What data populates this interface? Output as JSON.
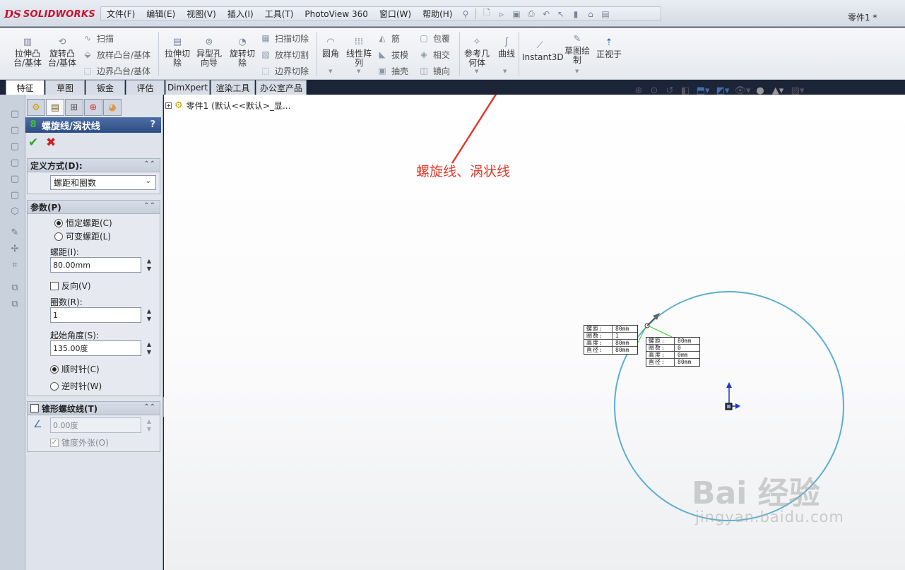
{
  "app": {
    "logo_ds": "DS",
    "logo_text": "SOLIDWORKS",
    "document_title": "零件1 *"
  },
  "menu": {
    "items": [
      "文件(F)",
      "编辑(E)",
      "视图(V)",
      "插入(I)",
      "工具(T)",
      "PhotoView 360",
      "窗口(W)",
      "帮助(H)"
    ]
  },
  "commands": {
    "extrude_boss": "拉伸凸台/基体",
    "revolve_boss": "旋转凸台/基体",
    "sweep": "扫描",
    "loft_boss": "放样凸台/基体",
    "boundary_boss": "边界凸台/基体",
    "extrude_cut": "拉伸切除",
    "hole_wizard": "异型孔向导",
    "revolve_cut": "旋转切除",
    "swept_cut": "扫描切除",
    "lofted_cut": "放样切割",
    "boundary_cut": "边界切除",
    "fillet": "圆角",
    "linear_pattern": "线性阵列",
    "rib": "筋",
    "draft": "拔模",
    "shell": "抽壳",
    "wrap": "包覆",
    "intersect": "相交",
    "mirror": "镜向",
    "ref_geometry": "参考几何体",
    "curves": "曲线",
    "instant3d": "Instant3D",
    "sketch": "草图绘制",
    "normal_to": "正视于"
  },
  "tabs": [
    "特征",
    "草图",
    "钣金",
    "评估",
    "DimXpert",
    "渲染工具",
    "办公室产品"
  ],
  "property_manager": {
    "title": "螺旋线/涡状线",
    "help": "?",
    "define_by": {
      "header": "定义方式(D):",
      "selected": "螺距和圈数"
    },
    "parameters": {
      "header": "参数(P)",
      "constant_pitch": "恒定螺距(C)",
      "variable_pitch": "可变螺距(L)",
      "pitch_label": "螺距(I):",
      "pitch_value": "80.00mm",
      "reverse": "反向(V)",
      "revolutions_label": "圈数(R):",
      "revolutions_value": "1",
      "start_angle_label": "起始角度(S):",
      "start_angle_value": "135.00度",
      "clockwise": "顺时针(C)",
      "counterclockwise": "逆时针(W)"
    },
    "taper": {
      "header": "锥形螺纹线(T)",
      "angle_value": "0.00度",
      "taper_outward": "锥度外张(O)"
    }
  },
  "tree": {
    "root": "零件1 (默认<<默认>_显..."
  },
  "annotation": {
    "text": "螺旋线、涡状线",
    "color": "#e33a2a"
  },
  "preview": {
    "start_table": [
      {
        "k": "螺距:",
        "v": "80mm"
      },
      {
        "k": "圈数:",
        "v": "1"
      },
      {
        "k": "高度:",
        "v": "80mm"
      },
      {
        "k": "直径:",
        "v": "80mm"
      }
    ],
    "end_table": [
      {
        "k": "螺距:",
        "v": "80mm"
      },
      {
        "k": "圈数:",
        "v": "0"
      },
      {
        "k": "高度:",
        "v": "0mm"
      },
      {
        "k": "直径:",
        "v": "80mm"
      }
    ],
    "helix_color": "#5aaed0"
  },
  "watermark": {
    "brand": "Bai 经验",
    "url": "jingyan.baidu.com"
  }
}
